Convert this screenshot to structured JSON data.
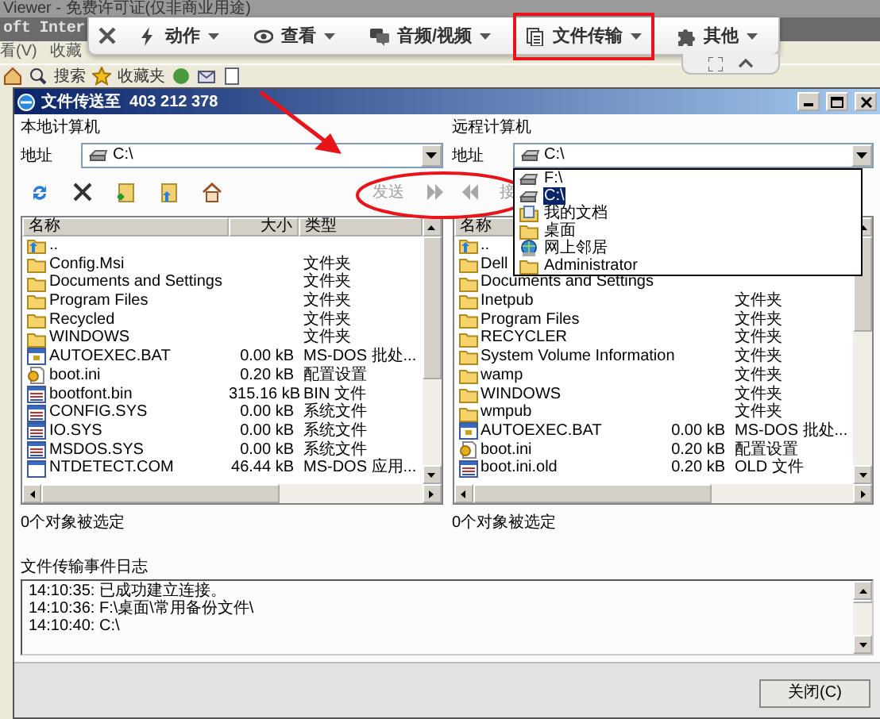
{
  "background": {
    "title": "Viewer - 免费许可证(仅非商业用途)",
    "browser": "oft Inter",
    "menu": [
      "看(V)",
      "收藏"
    ],
    "toolbar": [
      "搜索",
      "收藏夹"
    ]
  },
  "remote_toolbar": {
    "menus": [
      {
        "label": "动作",
        "kind": "action",
        "highlighted": false
      },
      {
        "label": "查看",
        "kind": "view",
        "highlighted": false
      },
      {
        "label": "音频/视频",
        "kind": "chat",
        "highlighted": false
      },
      {
        "label": "文件传输",
        "kind": "files",
        "highlighted": true
      },
      {
        "label": "其他",
        "kind": "other",
        "highlighted": false
      }
    ]
  },
  "dialog": {
    "title": "文件传送至  403 212 378",
    "local": {
      "heading": "本地计算机",
      "address_label": "地址",
      "address": "C:\\",
      "tools": [
        {
          "kind": "refresh"
        },
        {
          "kind": "delete"
        },
        {
          "kind": "new_folder"
        },
        {
          "kind": "parent_folder"
        },
        {
          "kind": "home"
        }
      ],
      "transfer": {
        "label": "发送",
        "kind": "send",
        "disabled": true
      },
      "columns": [
        "名称",
        "大小",
        "类型"
      ],
      "rows": [
        {
          "name": "..",
          "kind": "up"
        },
        {
          "name": "Config.Msi",
          "kind": "folder",
          "type": "文件夹"
        },
        {
          "name": "Documents and Settings",
          "kind": "folder",
          "type": "文件夹"
        },
        {
          "name": "Program Files",
          "kind": "folder",
          "type": "文件夹"
        },
        {
          "name": "Recycled",
          "kind": "folder",
          "type": "文件夹"
        },
        {
          "name": "WINDOWS",
          "kind": "folder",
          "type": "文件夹"
        },
        {
          "name": "AUTOEXEC.BAT",
          "kind": "bat",
          "size": "0.00 kB",
          "type": "MS-DOS 批处..."
        },
        {
          "name": "boot.ini",
          "kind": "ini",
          "size": "0.20 kB",
          "type": "配置设置"
        },
        {
          "name": "bootfont.bin",
          "kind": "sys",
          "size": "315.16 kB",
          "type": "BIN 文件"
        },
        {
          "name": "CONFIG.SYS",
          "kind": "sys",
          "size": "0.00 kB",
          "type": "系统文件"
        },
        {
          "name": "IO.SYS",
          "kind": "sys",
          "size": "0.00 kB",
          "type": "系统文件"
        },
        {
          "name": "MSDOS.SYS",
          "kind": "sys",
          "size": "0.00 kB",
          "type": "系统文件"
        },
        {
          "name": "NTDETECT.COM",
          "kind": "app",
          "size": "46.44 kB",
          "type": "MS-DOS 应用..."
        }
      ],
      "status": "0个对象被选定"
    },
    "remote": {
      "heading": "远程计算机",
      "address_label": "地址",
      "address": "C:\\",
      "transfer": {
        "label": "接",
        "kind": "receive",
        "disabled": true
      },
      "columns": [
        "名称"
      ],
      "dropdown": [
        {
          "label": "F:\\",
          "kind": "drive",
          "selected": false
        },
        {
          "label": "C:\\",
          "kind": "drive",
          "selected": true
        },
        {
          "label": "我的文档",
          "kind": "docs",
          "selected": false
        },
        {
          "label": "桌面",
          "kind": "folder",
          "selected": false
        },
        {
          "label": "网上邻居",
          "kind": "network",
          "selected": false
        },
        {
          "label": "Administrator",
          "kind": "folder",
          "selected": false
        }
      ],
      "rows": [
        {
          "name": "..",
          "kind": "up"
        },
        {
          "name": "Dell",
          "kind": "folder"
        },
        {
          "name": "Documents and Settings",
          "kind": "folder"
        },
        {
          "name": "Inetpub",
          "kind": "folder",
          "type": "文件夹"
        },
        {
          "name": "Program Files",
          "kind": "folder",
          "type": "文件夹"
        },
        {
          "name": "RECYCLER",
          "kind": "folder",
          "type": "文件夹"
        },
        {
          "name": "System Volume Information",
          "kind": "folder",
          "type": "文件夹"
        },
        {
          "name": "wamp",
          "kind": "folder",
          "type": "文件夹"
        },
        {
          "name": "WINDOWS",
          "kind": "folder",
          "type": "文件夹"
        },
        {
          "name": "wmpub",
          "kind": "folder",
          "type": "文件夹"
        },
        {
          "name": "AUTOEXEC.BAT",
          "kind": "bat",
          "size": "0.00 kB",
          "type": "MS-DOS 批处..."
        },
        {
          "name": "boot.ini",
          "kind": "ini",
          "size": "0.20 kB",
          "type": "配置设置"
        },
        {
          "name": "boot.ini.old",
          "kind": "sys",
          "size": "0.20 kB",
          "type": "OLD 文件"
        }
      ],
      "status": "0个对象被选定"
    },
    "log": {
      "label": "文件传输事件日志",
      "lines": [
        "14:10:35: 已成功建立连接。",
        "14:10:36: F:\\桌面\\常用备份文件\\",
        "14:10:40: C:\\"
      ]
    },
    "close_button": "关闭(C)"
  }
}
